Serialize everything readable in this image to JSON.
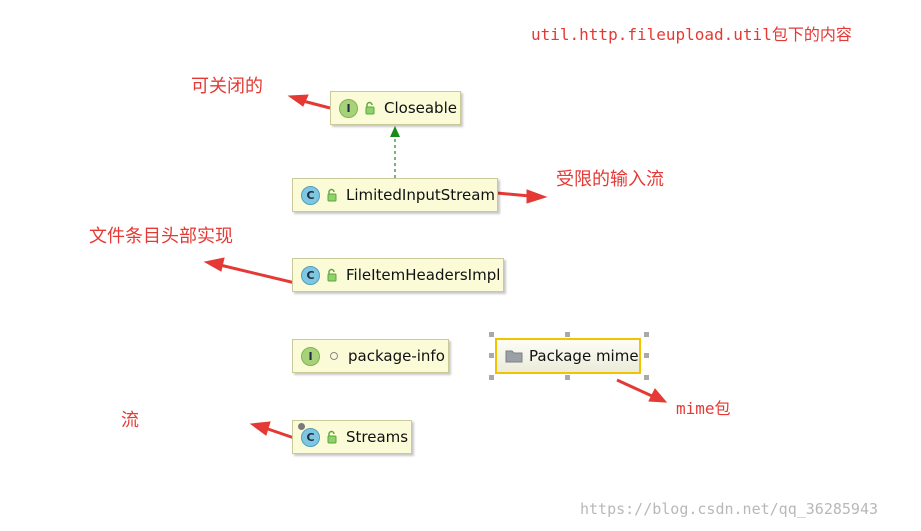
{
  "header_note": "util.http.fileupload.util包下的内容",
  "nodes": {
    "closeable": {
      "kind": "I",
      "name": "Closeable"
    },
    "limited": {
      "kind": "C",
      "name": "LimitedInputStream"
    },
    "headers": {
      "kind": "C",
      "name": "FileItemHeadersImpl"
    },
    "pkginfo": {
      "kind": "I",
      "name": "package-info"
    },
    "streams": {
      "kind": "C",
      "name": "Streams"
    }
  },
  "package": {
    "name": "Package mime"
  },
  "annotations": {
    "closeable": "可关闭的",
    "limited": "受限的输入流",
    "headers": "文件条目头部实现",
    "mime": "mime包",
    "streams": "流"
  },
  "watermark": "https://blog.csdn.net/qq_36285943",
  "colors": {
    "annotation": "#e53935",
    "inheritance_arrow": "#1a8a1a",
    "selection": "#f2c400",
    "node_fill": "#fbfbd8",
    "interface_badge": "#a7d27a",
    "class_badge": "#7fc7e0"
  }
}
